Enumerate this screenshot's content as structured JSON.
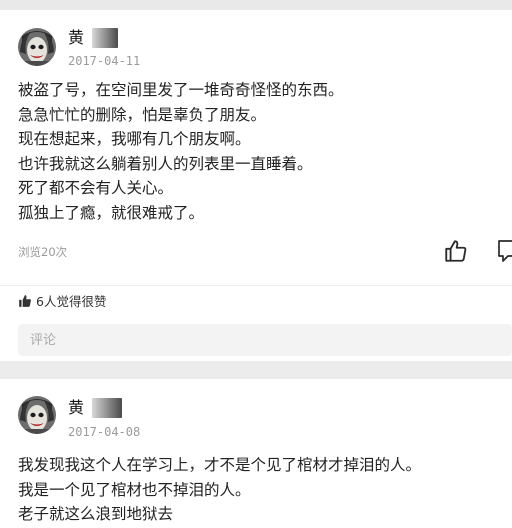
{
  "posts": [
    {
      "author": "黄",
      "date": "2017-04-11",
      "lines": [
        "被盗了号，在空间里发了一堆奇奇怪怪的东西。",
        "急急忙忙的删除，怕是辜负了朋友。",
        "现在想起来，我哪有几个朋友啊。",
        "也许我就这么躺着别人的列表里一直睡着。",
        "死了都不会有人关心。",
        "孤独上了瘾，就很难戒了。"
      ],
      "views": "浏览20次",
      "likes": "6人觉得很赞",
      "comment_placeholder": "评论"
    },
    {
      "author": "黄",
      "date": "2017-04-08",
      "lines": [
        "我发现我这个人在学习上，才不是个见了棺材才掉泪的人。",
        "我是一个见了棺材也不掉泪的人。",
        "老子就这么浪到地狱去"
      ]
    }
  ],
  "icons": {
    "avatar": "joker-avatar-icon",
    "like": "thumbs-up-icon",
    "message": "message-icon",
    "likes_badge": "thumbs-up-filled-icon"
  }
}
